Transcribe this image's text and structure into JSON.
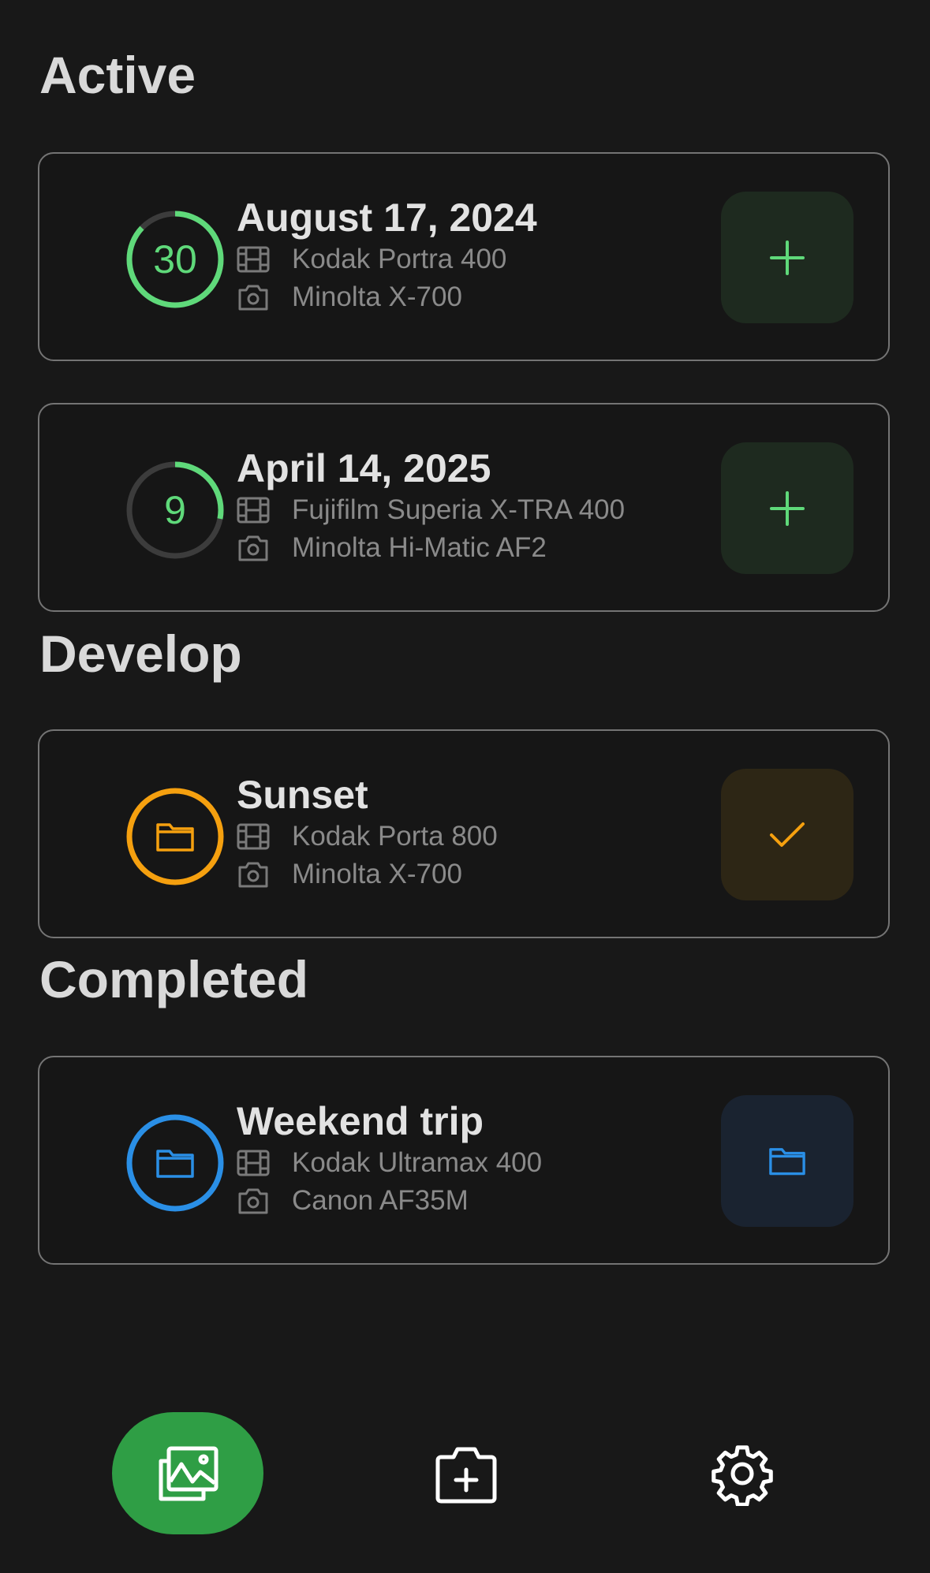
{
  "sections": {
    "active": "Active",
    "develop": "Develop",
    "completed": "Completed"
  },
  "cards": [
    {
      "title": "August 17, 2024",
      "film": "Kodak Portra 400",
      "camera": "Minolta X-700",
      "count": "30",
      "progress": 0.87,
      "badge_icon": "progress-ring",
      "action_icon": "plus-icon",
      "color": "#5fd97a",
      "action_bg": "#1e2a1f"
    },
    {
      "title": "April 14, 2025",
      "film": "Fujifilm Superia X-TRA 400",
      "camera": "Minolta Hi-Matic AF2",
      "count": "9",
      "progress": 0.28,
      "badge_icon": "progress-ring",
      "action_icon": "plus-icon",
      "color": "#5fd97a",
      "action_bg": "#1e2a1f"
    },
    {
      "title": "Sunset",
      "film": "Kodak Porta 800",
      "camera": "Minolta X-700",
      "badge_icon": "folder-icon",
      "action_icon": "check-icon",
      "color": "#f5a00f",
      "action_bg": "#2d2615"
    },
    {
      "title": "Weekend trip",
      "film": "Kodak Ultramax 400",
      "camera": "Canon AF35M",
      "badge_icon": "folder-icon",
      "action_icon": "folder-icon",
      "color": "#2a8fe6",
      "action_bg": "#1a2330"
    }
  ],
  "nav": {
    "items": [
      {
        "icon": "gallery-icon",
        "active": true
      },
      {
        "icon": "camera-add-icon",
        "active": false
      },
      {
        "icon": "gear-icon",
        "active": false
      }
    ],
    "active_color": "#2f9e45"
  }
}
